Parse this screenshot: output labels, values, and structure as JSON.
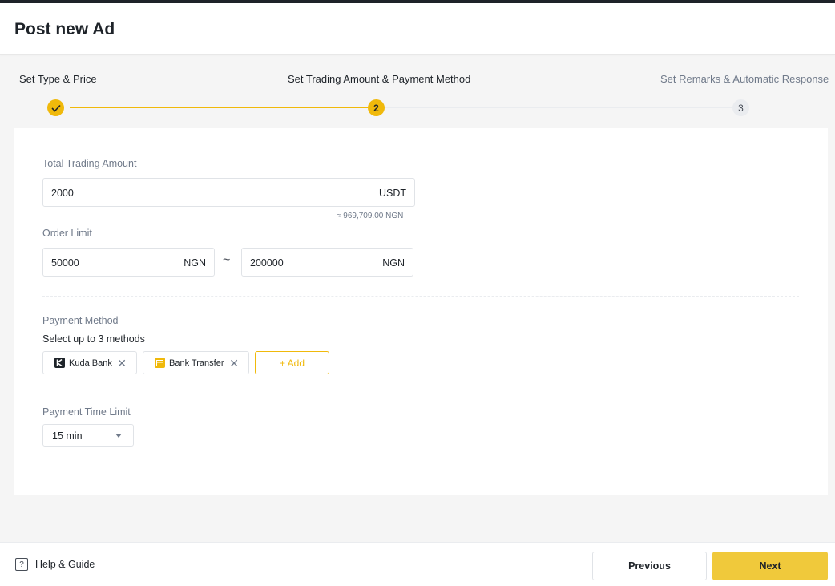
{
  "header": {
    "title": "Post new Ad"
  },
  "steps": [
    {
      "label": "Set Type & Price",
      "state": "done",
      "number": ""
    },
    {
      "label": "Set Trading Amount & Payment Method",
      "state": "active",
      "number": "2"
    },
    {
      "label": "Set Remarks & Automatic Response",
      "state": "pending",
      "number": "3"
    }
  ],
  "form": {
    "total_amount": {
      "label": "Total Trading Amount",
      "value": "2000",
      "unit": "USDT",
      "approx": "≈ 969,709.00 NGN"
    },
    "order_limit": {
      "label": "Order Limit",
      "min_value": "50000",
      "min_unit": "NGN",
      "separator": "~",
      "max_value": "200000",
      "max_unit": "NGN"
    },
    "payment_method": {
      "label": "Payment Method",
      "hint": "Select up to 3 methods",
      "methods": [
        {
          "name": "Kuda Bank",
          "icon": "kuda-bank-icon"
        },
        {
          "name": "Bank Transfer",
          "icon": "bank-transfer-icon"
        }
      ],
      "add_label": "+ Add"
    },
    "time_limit": {
      "label": "Payment Time Limit",
      "value": "15 min"
    }
  },
  "footer": {
    "help_label": "Help & Guide",
    "previous_label": "Previous",
    "next_label": "Next"
  },
  "colors": {
    "accent": "#f0b90b",
    "next_button": "#f0c93b",
    "text": "#1e2329",
    "muted": "#707a8a"
  }
}
